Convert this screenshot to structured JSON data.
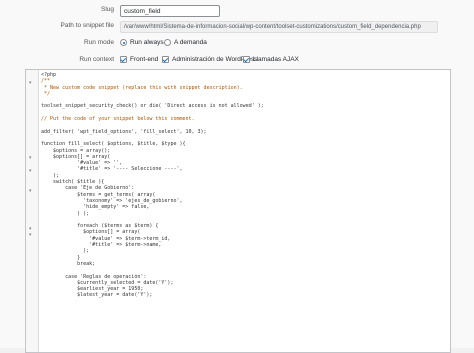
{
  "form": {
    "slug": {
      "label": "Slug",
      "value": "custom_field"
    },
    "path": {
      "label": "Path to snippet file",
      "value": "/var/www/html/Sistema-de-informacion-social/wp-content/toolset-customizations/custom_field_dependencia.php"
    },
    "run_mode": {
      "label": "Run mode",
      "options": [
        {
          "label": "Run always",
          "selected": true
        },
        {
          "label": "A demanda",
          "selected": false
        }
      ]
    },
    "run_context": {
      "label": "Run context",
      "options": [
        {
          "label": "Front-end",
          "checked": true
        },
        {
          "label": "Administración de WordPress",
          "checked": true
        },
        {
          "label": "Llamadas AJAX",
          "checked": true
        }
      ]
    }
  },
  "editor": {
    "lines": [
      "<?php",
      "/**",
      " * New custom code snippet (replace this with snippet description).",
      " */",
      "",
      "toolset_snippet_security_check() or die( 'Direct access is not allowed' );",
      "",
      "// Put the code of your snippet below this comment.",
      "",
      "add_filter( 'wpt_field_options', 'fill_select', 10, 3);",
      "",
      "function fill_select( $options, $title, $type ){",
      "    $options = array();",
      "    $options[] = array(",
      "            '#value' => '',",
      "            '#title' => '---- Seleccione ----',",
      "    );",
      "    switch( $title ){",
      "        case 'Eje de Gobierno':",
      "            $terms = get_terms( array(",
      "              'taxonomy' => 'ejes_de_gobierno',",
      "              'hide_empty' => false,",
      "            ) );",
      "",
      "            foreach ($terms as $term) {",
      "              $options[] = array(",
      "                '#value' => $term->term_id,",
      "                '#title' => $term->name,",
      "              );",
      "            }",
      "            break;",
      "",
      "        case 'Reglas de operación':",
      "            $currently_selected = date('Y');",
      "            $earliest_year = 1950;",
      "            $latest_year = date('Y');"
    ]
  }
}
